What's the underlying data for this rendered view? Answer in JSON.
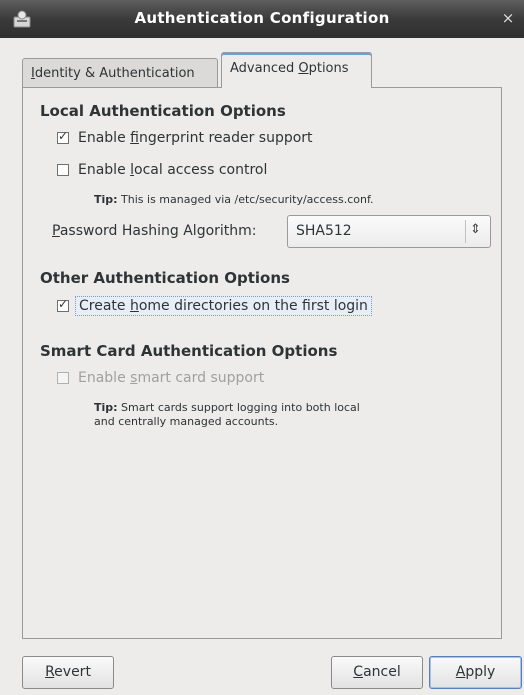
{
  "window": {
    "title": "Authentication Configuration",
    "close_glyph": "×"
  },
  "tabs": [
    {
      "label_pre": "",
      "label_mnemonic": "I",
      "label_post": "dentity & Authentication",
      "active": false
    },
    {
      "label_pre": "Advanced ",
      "label_mnemonic": "O",
      "label_post": "ptions",
      "active": true
    }
  ],
  "local": {
    "heading": "Local Authentication Options",
    "fingerprint": {
      "pre": "Enable ",
      "mn": "f",
      "post": "ingerprint reader support",
      "checked": true
    },
    "access": {
      "pre": "Enable ",
      "mn": "l",
      "post": "ocal access control",
      "checked": false
    },
    "tip_label": "Tip:",
    "tip_text": " This is managed via /etc/security/access.conf.",
    "hash_label_mn": "P",
    "hash_label_post": "assword Hashing Algorithm:",
    "hash_value": "SHA512",
    "hash_arrow": "⇕"
  },
  "other": {
    "heading": "Other Authentication Options",
    "homedir": {
      "pre": "Create ",
      "mn": "h",
      "post": "ome directories on the first login",
      "checked": true
    }
  },
  "smartcard": {
    "heading": "Smart Card Authentication Options",
    "enable": {
      "pre": "Enable ",
      "mn": "s",
      "post": "mart card support",
      "checked": false,
      "enabled": false
    },
    "tip_label": "Tip:",
    "tip_line1": " Smart cards support logging into both local",
    "tip_line2": "and centrally managed accounts."
  },
  "buttons": {
    "revert": {
      "mn": "R",
      "post": "evert"
    },
    "cancel": {
      "mn": "C",
      "post": "ancel"
    },
    "apply": {
      "mn": "A",
      "post": "pply"
    }
  },
  "colors": {
    "titlebar": "#3a3a3a",
    "focus_accent": "#6e9fd8"
  },
  "icons": {
    "window": "user-lock-icon",
    "close": "close-icon",
    "combo": "up-down-arrows-icon"
  }
}
